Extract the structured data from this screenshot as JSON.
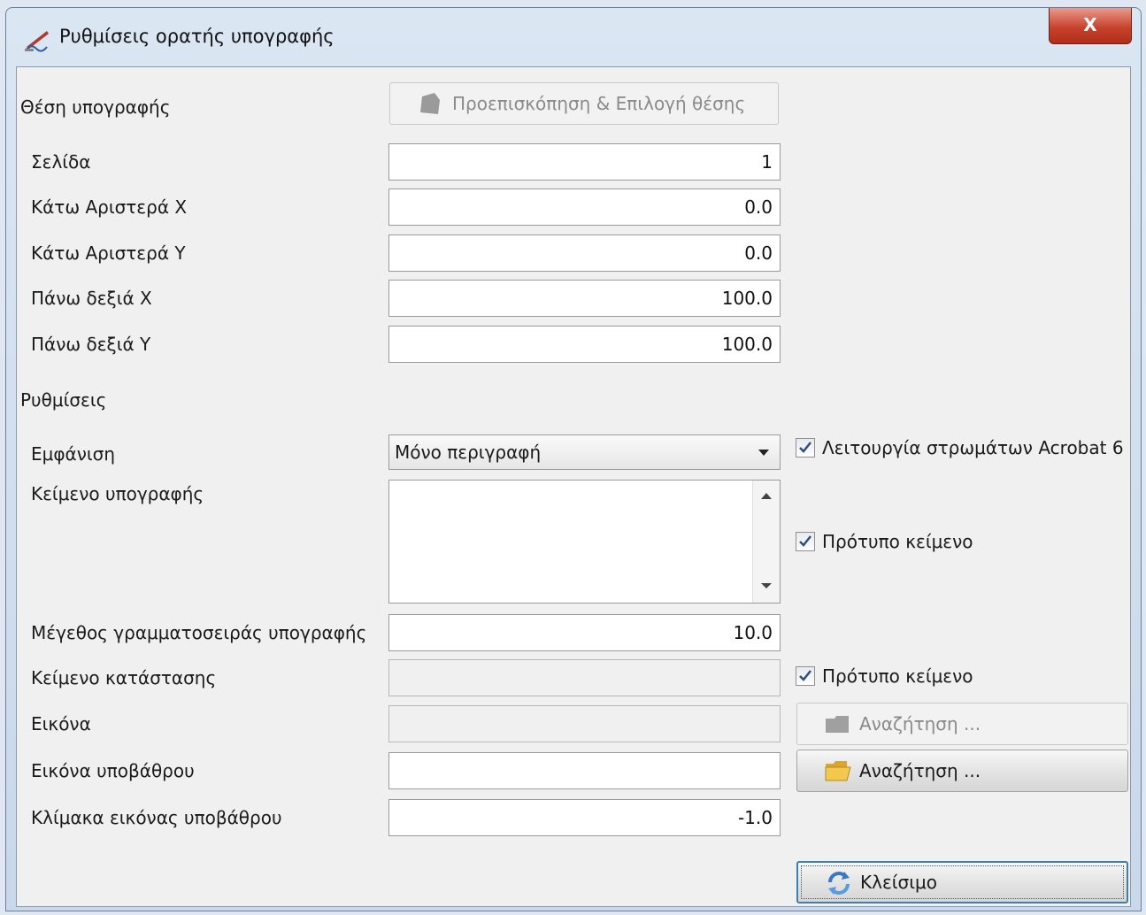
{
  "window": {
    "title": "Ρυθμίσεις ορατής υπογραφής",
    "close_label": "X"
  },
  "position": {
    "section_title": "Θέση υπογραφής",
    "preview_button": "Προεπισκόπηση & Επιλογή θέσης",
    "fields": [
      {
        "label": "Σελίδα",
        "value": "1"
      },
      {
        "label": "Κάτω Αριστερά X",
        "value": "0.0"
      },
      {
        "label": "Κάτω Αριστερά Y",
        "value": "0.0"
      },
      {
        "label": "Πάνω δεξιά X",
        "value": "100.0"
      },
      {
        "label": "Πάνω δεξιά Y",
        "value": "100.0"
      }
    ]
  },
  "settings": {
    "section_title": "Ρυθμίσεις",
    "appearance_label": "Εμφάνιση",
    "appearance_value": "Μόνο περιγραφή",
    "acrobat_layers_label": "Λειτουργία στρωμάτων Acrobat 6",
    "acrobat_layers_checked": true,
    "signature_text_label": "Κείμενο υπογραφής",
    "signature_text_value": "",
    "signature_template_label": "Πρότυπο κείμενο",
    "signature_template_checked": true,
    "font_size_label": "Μέγεθος γραμματοσειράς υπογραφής",
    "font_size_value": "10.0",
    "status_text_label": "Κείμενο κατάστασης",
    "status_text_value": "",
    "status_template_label": "Πρότυπο κείμενο",
    "status_template_checked": true,
    "image_label": "Εικόνα",
    "image_value": "",
    "image_browse": "Αναζήτηση ...",
    "bg_image_label": "Εικόνα υποβάθρου",
    "bg_image_value": "",
    "bg_image_browse": "Αναζήτηση ...",
    "bg_scale_label": "Κλίμακα εικόνας υποβάθρου",
    "bg_scale_value": "-1.0"
  },
  "footer": {
    "close_button": "Κλείσιμο"
  },
  "colors": {
    "accent": "#3c7fb1",
    "close_red": "#c8432e",
    "folder_yellow": "#f2c94c"
  }
}
